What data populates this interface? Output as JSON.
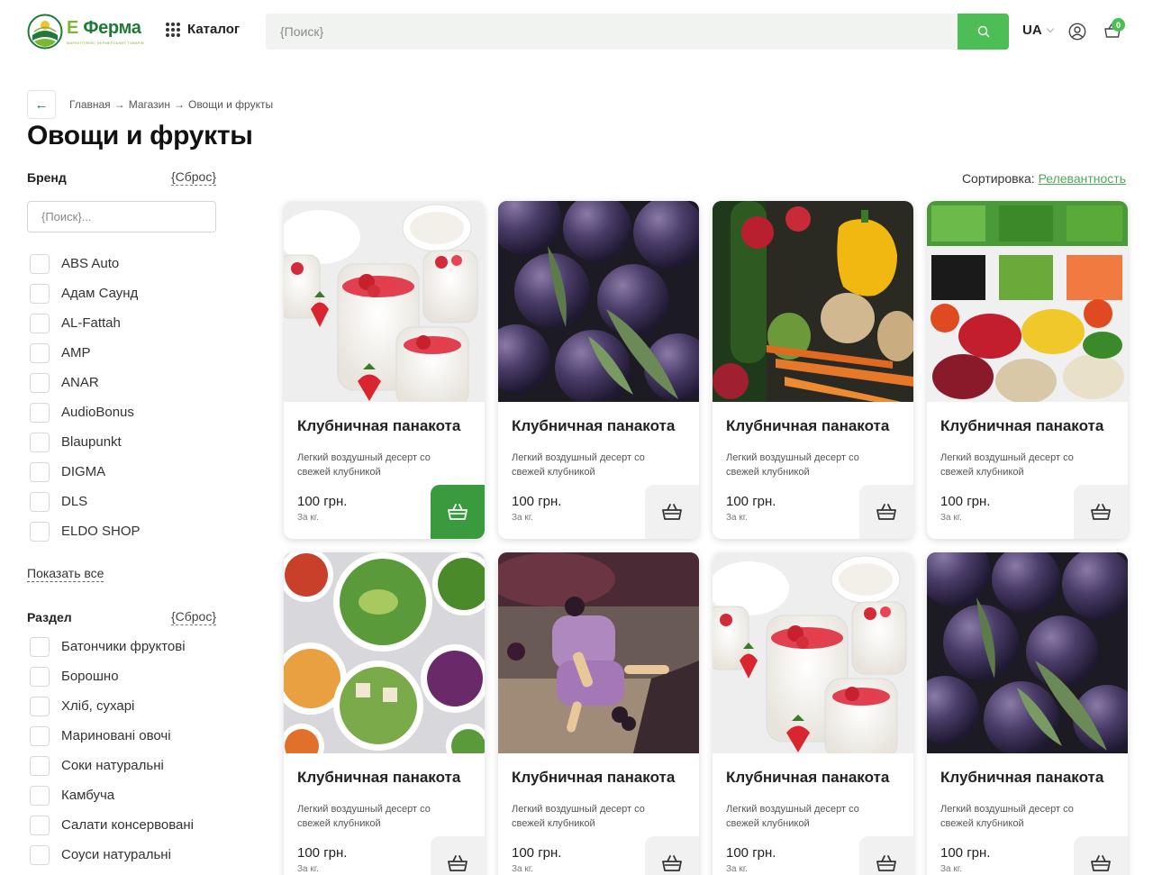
{
  "header": {
    "logo_word_e": "Е",
    "logo_word_rest": "Ферма",
    "logo_tagline": "МАРКЕТПЛЕЙС ФЕРМЕРСЬКИХ ТОВАРІВ",
    "catalog_label": "Каталог",
    "search_placeholder": "{Поиск}",
    "lang": "UA",
    "cart_count": "0",
    "icons": [
      "grid-dots-icon",
      "search-icon",
      "chevron-down-icon",
      "user-icon",
      "basket-icon"
    ],
    "accent_color": "#4cbe55"
  },
  "breadcrumb": {
    "items": [
      "Главная",
      "Магазин",
      "Овощи и фрукты"
    ],
    "separator": "→",
    "back_arrow": "←"
  },
  "page_title": "Овощи и фрукты",
  "brand_filter": {
    "title": "Бренд",
    "reset": "{Сброс}",
    "search_placeholder": "{Поиск}...",
    "items": [
      "ABS Auto",
      "Адам Саунд",
      "AL-Fattah",
      "AMP",
      "ANAR",
      "AudioBonus",
      "Blaupunkt",
      "DIGMA",
      "DLS",
      "ELDO SHOP"
    ],
    "show_all": "Показать все"
  },
  "section_filter": {
    "title": "Раздел",
    "reset": "{Сброс}",
    "items": [
      "Батончики фруктові",
      "Борошно",
      "Хліб, сухарі",
      "Мариновані овочі",
      "Соки натуральні",
      "Камбуча",
      "Салати консервовані",
      "Соуси натуральні"
    ]
  },
  "sort": {
    "label": "Сортировка:",
    "value": "Релевантность"
  },
  "products": [
    {
      "title": "Клубничная панакота",
      "desc": "Легкий воздушный десерт со свежей клубникой",
      "price": "100 грн.",
      "unit": "За кг.",
      "image": "panna-cotta",
      "cart_active": true
    },
    {
      "title": "Клубничная панакота",
      "desc": "Легкий воздушный десерт со свежей клубникой",
      "price": "100 грн.",
      "unit": "За кг.",
      "image": "plums",
      "cart_active": false
    },
    {
      "title": "Клубничная панакота",
      "desc": "Легкий воздушный десерт со свежей клубникой",
      "price": "100 грн.",
      "unit": "За кг.",
      "image": "vegetables",
      "cart_active": false
    },
    {
      "title": "Клубничная панакота",
      "desc": "Легкий воздушный десерт со свежей клубникой",
      "price": "100 грн.",
      "unit": "За кг.",
      "image": "salad-bar",
      "cart_active": false
    },
    {
      "title": "Клубничная панакота",
      "desc": "Легкий воздушный десерт со свежей клубникой",
      "price": "100 грн.",
      "unit": "За кг.",
      "image": "salad-bowls",
      "cart_active": false
    },
    {
      "title": "Клубничная панакота",
      "desc": "Легкий воздушный десерт со свежей клубникой",
      "price": "100 грн.",
      "unit": "За кг.",
      "image": "popsicle",
      "cart_active": false
    },
    {
      "title": "Клубничная панакота",
      "desc": "Легкий воздушный десерт со свежей клубникой",
      "price": "100 грн.",
      "unit": "За кг.",
      "image": "panna-cotta",
      "cart_active": false
    },
    {
      "title": "Клубничная панакота",
      "desc": "Легкий воздушный десерт со свежей клубникой",
      "price": "100 грн.",
      "unit": "За кг.",
      "image": "plums",
      "cart_active": false
    }
  ]
}
